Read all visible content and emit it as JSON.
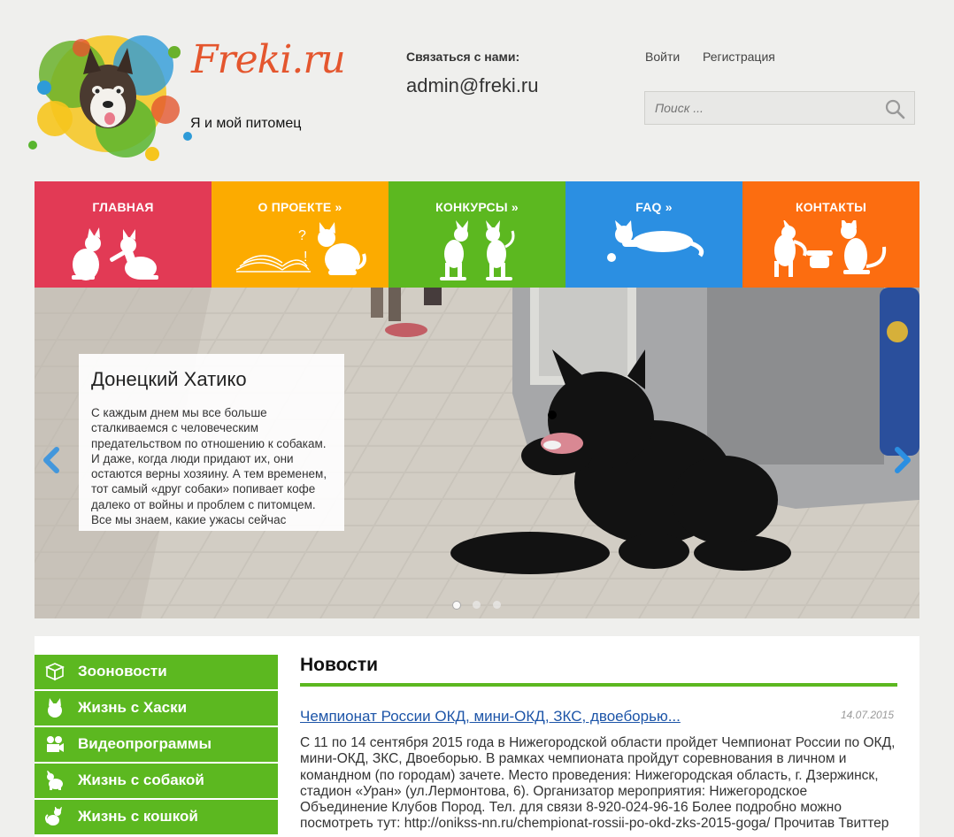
{
  "header": {
    "brand": "Freki.ru",
    "tagline": "Я и мой питомец",
    "contact_label": "Связаться с нами:",
    "contact_email": "admin@freki.ru",
    "login": "Войти",
    "register": "Регистрация",
    "search_placeholder": "Поиск ..."
  },
  "nav": [
    {
      "label": "ГЛАВНАЯ",
      "color": "#e23a55"
    },
    {
      "label": "О ПРОЕКТЕ »",
      "color": "#fcab00"
    },
    {
      "label": "КОНКУРСЫ »",
      "color": "#5cb820"
    },
    {
      "label": "FAQ »",
      "color": "#2b8fe2"
    },
    {
      "label": "КОНТАКТЫ",
      "color": "#fc6d10"
    }
  ],
  "slider": {
    "title": "Донецкий Хатико",
    "text": "С каждым днем мы все больше сталкиваемся с человеческим предательством по отношению к собакам. И даже, когда люди придают их, они остаются верны хозяину. А тем временем, тот самый «друг собаки» попивает кофе далеко от войны и проблем с питомцем. Все мы знаем, какие ужасы сейчас творятся в",
    "slides_total": 3,
    "active_slide": 1
  },
  "sidebar": [
    {
      "label": "Зооновости",
      "icon": "box-icon"
    },
    {
      "label": "Жизнь с Хаски",
      "icon": "husky-icon"
    },
    {
      "label": "Видеопрограммы",
      "icon": "camera-icon"
    },
    {
      "label": "Жизнь с собакой",
      "icon": "dog-icon"
    },
    {
      "label": "Жизнь с кошкой",
      "icon": "cat-icon"
    }
  ],
  "news": {
    "heading": "Новости",
    "item_title": "Чемпионат России ОКД, мини-ОКД, ЗКС, двоеборью...",
    "item_date": "14.07.2015",
    "item_text": "С 11 по 14 сентября 2015 года в Нижегородской области пройдет Чемпионат России по ОКД, мини-ОКД, ЗКС, Двоеборью. В рамках чемпионата пройдут соревнования в личном и командном (по городам) зачете. Место проведения: Нижегородская область, г. Дзержинск, стадион «Уран» (ул.Лермонтова, 6). Организатор мероприятия: Нижегородское Объединение Клубов Пород. Тел. для связи 8-920-024-96-16 Более подробно можно посмотреть тут: http://onikss-nn.ru/chempionat-rossii-po-okd-zks-2015-goga/ Прочитав Твиттер"
  }
}
